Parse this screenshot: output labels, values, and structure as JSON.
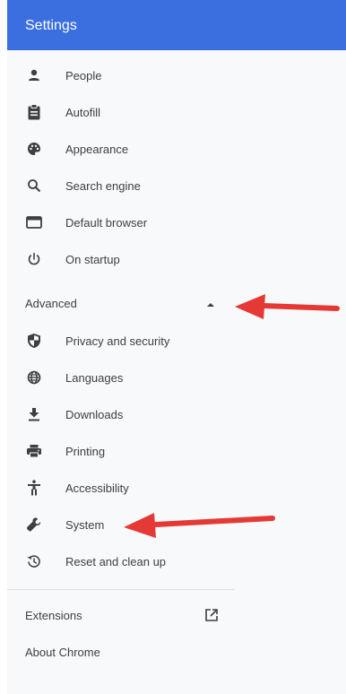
{
  "header": {
    "title": "Settings"
  },
  "nav": {
    "items": [
      {
        "label": "People",
        "icon": "person-icon"
      },
      {
        "label": "Autofill",
        "icon": "clipboard-icon"
      },
      {
        "label": "Appearance",
        "icon": "palette-icon"
      },
      {
        "label": "Search engine",
        "icon": "search-icon"
      },
      {
        "label": "Default browser",
        "icon": "browser-window-icon"
      },
      {
        "label": "On startup",
        "icon": "power-icon"
      }
    ],
    "advanced": {
      "label": "Advanced",
      "expanded": true,
      "items": [
        {
          "label": "Privacy and security",
          "icon": "shield-icon"
        },
        {
          "label": "Languages",
          "icon": "globe-icon"
        },
        {
          "label": "Downloads",
          "icon": "download-icon"
        },
        {
          "label": "Printing",
          "icon": "printer-icon"
        },
        {
          "label": "Accessibility",
          "icon": "accessibility-icon"
        },
        {
          "label": "System",
          "icon": "wrench-icon"
        },
        {
          "label": "Reset and clean up",
          "icon": "restore-icon"
        }
      ]
    },
    "links": [
      {
        "label": "Extensions",
        "icon": "open-in-new-icon"
      },
      {
        "label": "About Chrome"
      }
    ]
  },
  "colors": {
    "header_bg": "#3b6fe0",
    "sidebar_bg": "#f8f9fa",
    "text": "#3c4043",
    "icon": "#3c4043",
    "annotation_arrow": "#e53935"
  }
}
